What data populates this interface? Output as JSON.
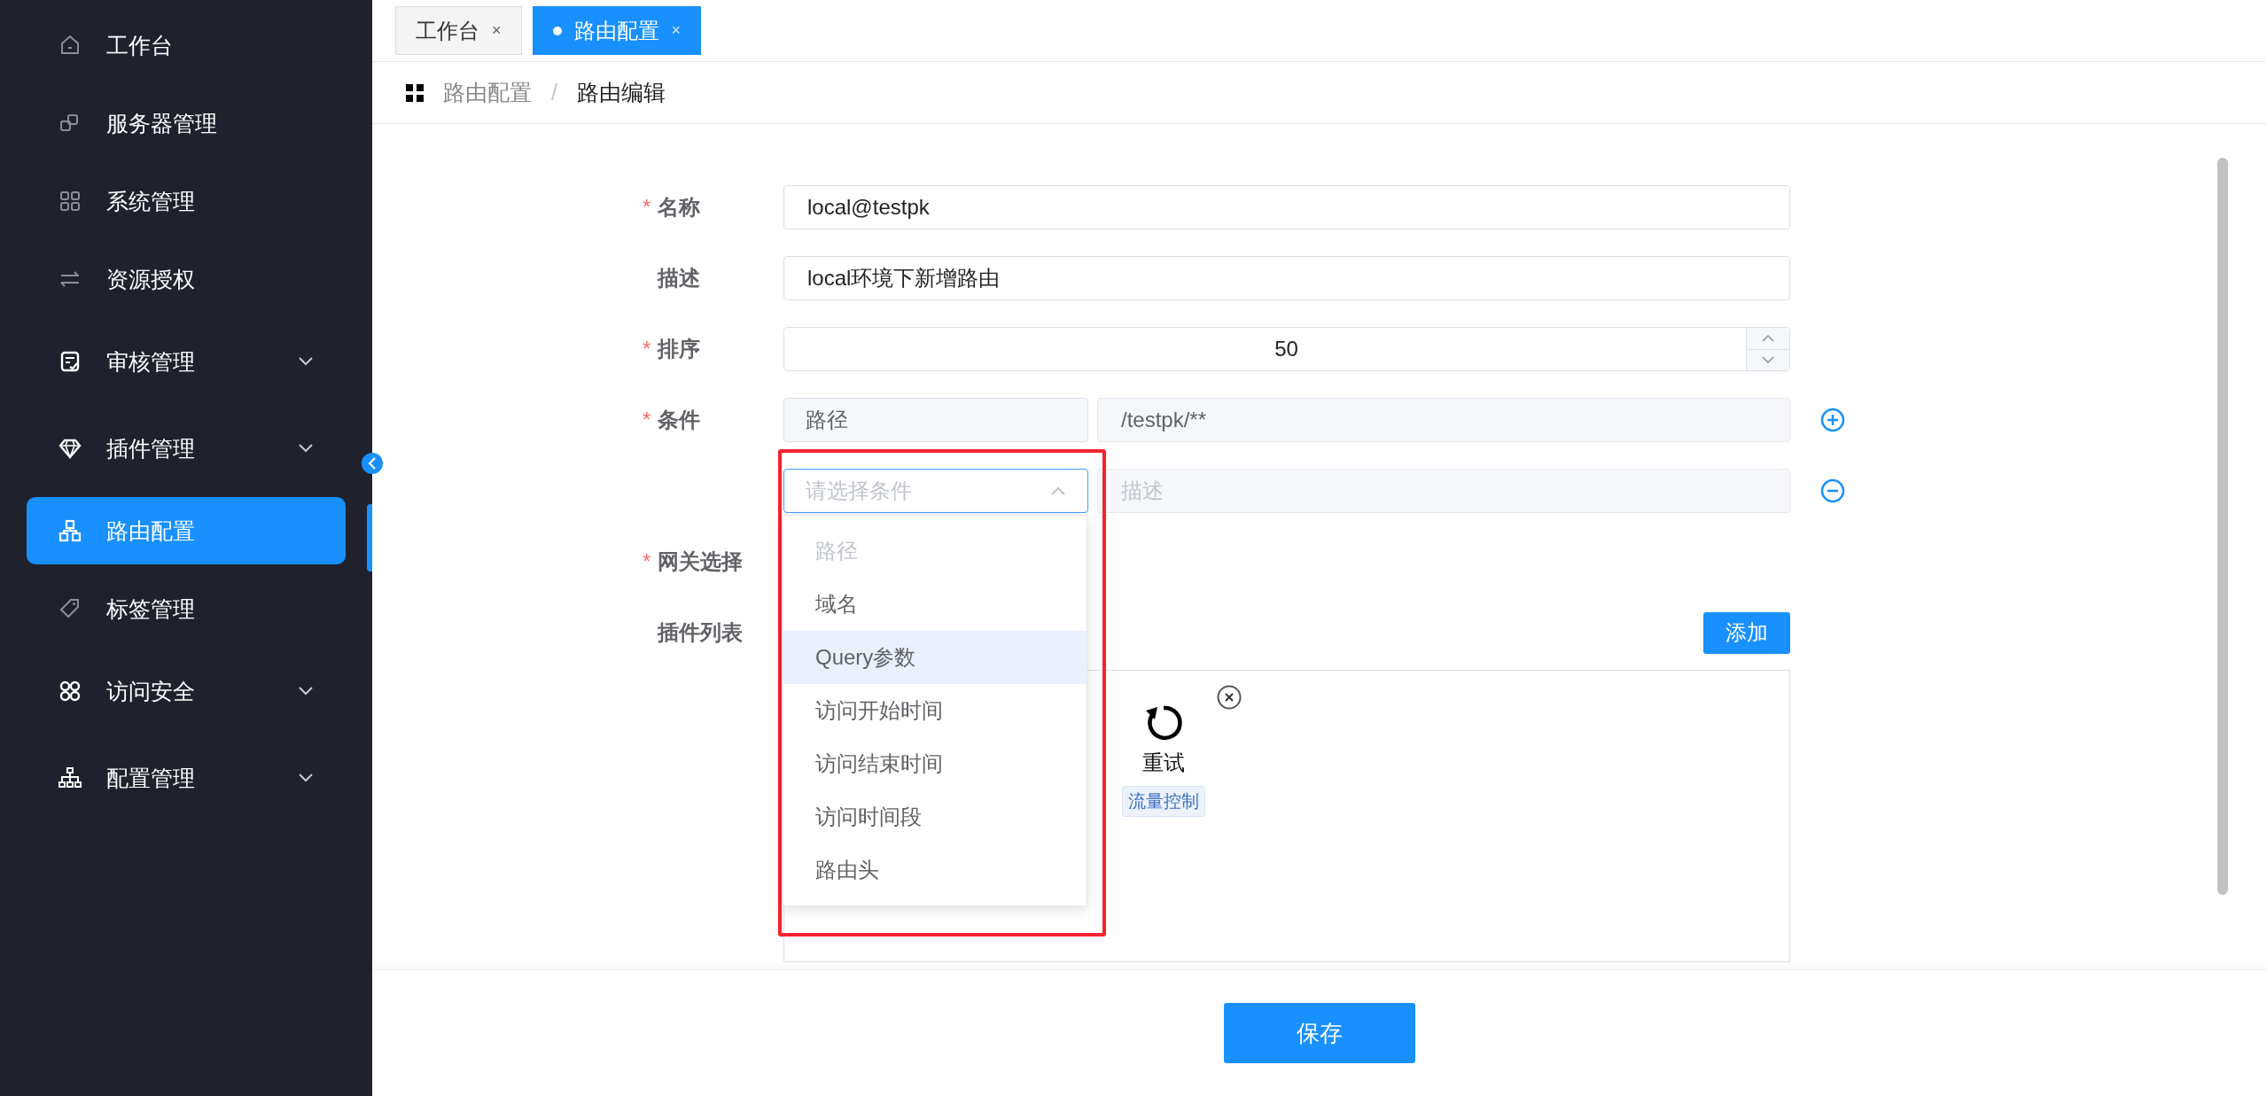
{
  "sidebar": {
    "items": [
      {
        "label": "工作台",
        "expandable": false,
        "selected": false
      },
      {
        "label": "服务器管理",
        "expandable": false,
        "selected": false
      },
      {
        "label": "系统管理",
        "expandable": false,
        "selected": false
      },
      {
        "label": "资源授权",
        "expandable": false,
        "selected": false
      },
      {
        "label": "审核管理",
        "expandable": true,
        "selected": false
      },
      {
        "label": "插件管理",
        "expandable": true,
        "selected": false
      },
      {
        "label": "路由配置",
        "expandable": false,
        "selected": true
      },
      {
        "label": "标签管理",
        "expandable": false,
        "selected": false
      },
      {
        "label": "访问安全",
        "expandable": true,
        "selected": false
      },
      {
        "label": "配置管理",
        "expandable": true,
        "selected": false
      }
    ]
  },
  "tabs": [
    {
      "label": "工作台",
      "close": "×",
      "selected": false
    },
    {
      "label": "路由配置",
      "close": "×",
      "selected": true
    }
  ],
  "breadcrumb": {
    "items": [
      "路由配置",
      "路由编辑"
    ],
    "separator": "/"
  },
  "form": {
    "fields": [
      {
        "kind": "text",
        "required_mark": "*",
        "label": "名称",
        "value": "local@testpk"
      },
      {
        "kind": "text",
        "label": "描述",
        "value": "local环境下新增路由"
      },
      {
        "kind": "number",
        "required_mark": "*",
        "label": "排序",
        "value": "50"
      },
      {
        "kind": "conditions",
        "required_mark": "*",
        "label": "条件",
        "rows": [
          {
            "kind": "add",
            "type": "路径",
            "value": "/testpk/**"
          },
          {
            "kind": "remove",
            "type_placeholder": "请选择条件",
            "value_placeholder": "描述",
            "open": true,
            "options": [
              {
                "label": "路径",
                "disabled": true,
                "hovered": false,
                "selected": false
              },
              {
                "label": "域名",
                "disabled": false,
                "hovered": false,
                "selected": false
              },
              {
                "label": "Query参数",
                "disabled": false,
                "hovered": true,
                "selected": false
              },
              {
                "label": "访问开始时间",
                "disabled": false,
                "hovered": false,
                "selected": false
              },
              {
                "label": "访问结束时间",
                "disabled": false,
                "hovered": false,
                "selected": false
              },
              {
                "label": "访问时间段",
                "disabled": false,
                "hovered": false,
                "selected": false
              },
              {
                "label": "路由头",
                "disabled": false,
                "hovered": false,
                "selected": false
              }
            ]
          }
        ]
      },
      {
        "kind": "empty",
        "required_mark": "*",
        "label": "网关选择"
      },
      {
        "kind": "plugins",
        "label": "插件列表",
        "add_button": "添加",
        "plugins": [
          {
            "name": "重试",
            "tag": "流量控制"
          }
        ]
      }
    ]
  },
  "footer": {
    "save_button": "保存"
  }
}
